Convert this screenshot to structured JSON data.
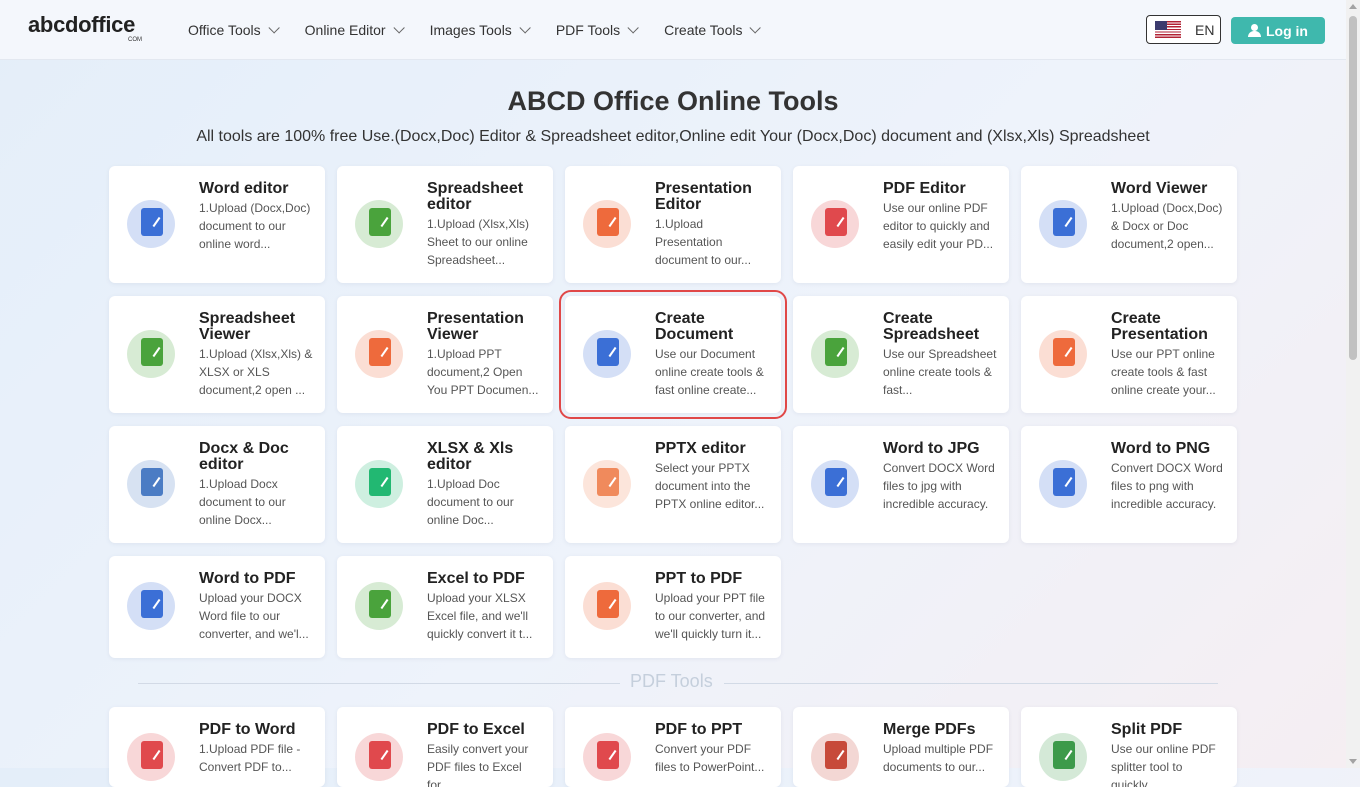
{
  "header": {
    "logo": "abcdoffice",
    "logo_sub": "COM",
    "nav": [
      "Office Tools",
      "Online Editor",
      "Images Tools",
      "PDF Tools",
      "Create Tools"
    ],
    "language": "EN",
    "login": "Log in"
  },
  "hero": {
    "title": "ABCD Office Online Tools",
    "subtitle": "All tools are 100% free Use.(Docx,Doc) Editor & Spreadsheet editor,Online edit Your (Docx,Doc) document and (Xlsx,Xls) Spreadsheet"
  },
  "cards": [
    {
      "title": "Word editor",
      "desc": "1.Upload (Docx,Doc) document to our online word...",
      "icon": "word-edit-icon",
      "color": "#3b6fd6"
    },
    {
      "title": "Spreadsheet editor",
      "desc": "1.Upload (Xlsx,Xls) Sheet to our online Spreadsheet...",
      "icon": "excel-edit-icon",
      "color": "#4aa33c"
    },
    {
      "title": "Presentation Editor",
      "desc": "1.Upload Presentation document to our...",
      "icon": "ppt-edit-icon",
      "color": "#ee6a3c"
    },
    {
      "title": "PDF Editor",
      "desc": "Use our online PDF editor to quickly and easily edit your PD...",
      "icon": "pdf-edit-icon",
      "color": "#e0494d"
    },
    {
      "title": "Word Viewer",
      "desc": "1.Upload (Docx,Doc) & Docx or Doc document,2 open...",
      "icon": "word-view-icon",
      "color": "#3b6fd6"
    },
    {
      "title": "Spreadsheet Viewer",
      "desc": "1.Upload (Xlsx,Xls) & XLSX or XLS document,2 open ...",
      "icon": "excel-view-icon",
      "color": "#4aa33c"
    },
    {
      "title": "Presentation Viewer",
      "desc": "1.Upload PPT document,2 Open You PPT Documen...",
      "icon": "ppt-view-icon",
      "color": "#ee6a3c"
    },
    {
      "title": "Create Document",
      "desc": "Use our Document online create tools & fast online create...",
      "icon": "word-create-icon",
      "color": "#3b6fd6"
    },
    {
      "title": "Create Spreadsheet",
      "desc": "Use our Spreadsheet online create tools & fast...",
      "icon": "excel-create-icon",
      "color": "#4aa33c"
    },
    {
      "title": "Create Presentation",
      "desc": "Use our PPT online create tools & fast online create your...",
      "icon": "ppt-create-icon",
      "color": "#ee6a3c"
    },
    {
      "title": "Docx & Doc editor",
      "desc": "1.Upload Docx document to our online Docx...",
      "icon": "docx-edit-icon",
      "color": "#4b7cc4"
    },
    {
      "title": "XLSX & Xls editor",
      "desc": "1.Upload Doc document to our online Doc...",
      "icon": "xlsx-edit-icon",
      "color": "#22b872"
    },
    {
      "title": "PPTX editor",
      "desc": "Select your PPTX document into the PPTX online editor...",
      "icon": "pptx-edit-icon",
      "color": "#f08a5c"
    },
    {
      "title": "Word to JPG",
      "desc": "Convert DOCX Word files to jpg with incredible accuracy.",
      "icon": "word-to-jpg-icon",
      "color": "#3b6fd6"
    },
    {
      "title": "Word to PNG",
      "desc": "Convert DOCX Word files to png with incredible accuracy.",
      "icon": "word-to-png-icon",
      "color": "#3b6fd6"
    },
    {
      "title": "Word to PDF",
      "desc": "Upload your DOCX Word file to our converter, and we'l...",
      "icon": "word-to-pdf-icon",
      "color": "#3b6fd6"
    },
    {
      "title": "Excel to PDF",
      "desc": "Upload your XLSX Excel file, and we'll quickly convert it t...",
      "icon": "excel-to-pdf-icon",
      "color": "#4aa33c"
    },
    {
      "title": "PPT to PDF",
      "desc": "Upload your PPT file to our converter, and we'll quickly turn it...",
      "icon": "ppt-to-pdf-icon",
      "color": "#ee6a3c"
    }
  ],
  "pdf_section": {
    "label": "PDF Tools",
    "cards": [
      {
        "title": "PDF to Word",
        "desc": "1.Upload PDF file - Convert PDF to...",
        "icon": "pdf-to-word-icon",
        "color": "#e0494d"
      },
      {
        "title": "PDF to Excel",
        "desc": "Easily convert your PDF files to Excel for...",
        "icon": "pdf-to-excel-icon",
        "color": "#e0494d"
      },
      {
        "title": "PDF to PPT",
        "desc": "Convert your PDF files to PowerPoint...",
        "icon": "pdf-to-ppt-icon",
        "color": "#e0494d"
      },
      {
        "title": "Merge PDFs",
        "desc": "Upload multiple PDF documents to our...",
        "icon": "merge-pdf-icon",
        "color": "#c74a3a"
      },
      {
        "title": "Split PDF",
        "desc": "Use our online PDF splitter tool to quickly...",
        "icon": "split-pdf-icon",
        "color": "#3c9a4a"
      }
    ]
  }
}
